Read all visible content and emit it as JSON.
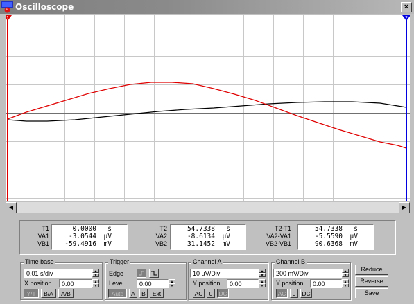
{
  "window": {
    "title": "Oscilloscope",
    "close_glyph": "×"
  },
  "icons": {
    "app": "oscilloscope-app-icon",
    "close": "close-icon"
  },
  "colors": {
    "channel_a": "#000000",
    "channel_b": "#e00000",
    "cursor_1": "#e00000",
    "cursor_2": "#0000e0",
    "grid": "#c8c8c8"
  },
  "cursors": {
    "t1_marker": "1",
    "t2_marker": "2"
  },
  "readout": {
    "col1": {
      "labels": [
        "T1",
        "VA1",
        "VB1"
      ],
      "values": [
        "0.0000",
        "-3.0544",
        "-59.4916"
      ],
      "units": [
        "s",
        "µV",
        "mV"
      ]
    },
    "col2": {
      "labels": [
        "T2",
        "VA2",
        "VB2"
      ],
      "values": [
        "54.7338",
        "-8.6134",
        "31.1452"
      ],
      "units": [
        "s",
        "µV",
        "mV"
      ]
    },
    "col3": {
      "labels": [
        "T2-T1",
        "VA2-VA1",
        "VB2-VB1"
      ],
      "values": [
        "54.7338",
        "-5.5590",
        "90.6368"
      ],
      "units": [
        "s",
        "µV",
        "mV"
      ]
    }
  },
  "timebase": {
    "title": "Time base",
    "value": "0.01 s/div",
    "xpos_label": "X position",
    "xpos_value": "0.00",
    "buttons": [
      "Y/T",
      "B/A",
      "A/B"
    ]
  },
  "trigger": {
    "title": "Trigger",
    "edge_label": "Edge",
    "level_label": "Level",
    "level_value": "0.00",
    "buttons": [
      "Auto",
      "A",
      "B",
      "Ext"
    ]
  },
  "channel_a": {
    "title": "Channel A",
    "value": "10 µV/Div",
    "ypos_label": "Y position",
    "ypos_value": "0.00",
    "buttons": [
      "AC",
      "0",
      "DC"
    ]
  },
  "channel_b": {
    "title": "Channel B",
    "value": "200 mV/Div",
    "ypos_label": "Y position",
    "ypos_value": "0.00",
    "buttons": [
      "AC",
      "0",
      "DC"
    ]
  },
  "actions": {
    "reduce": "Reduce",
    "reverse": "Reverse",
    "save": "Save"
  }
}
